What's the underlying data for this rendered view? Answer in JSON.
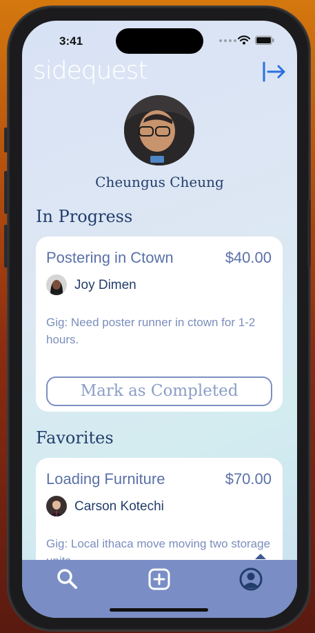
{
  "status": {
    "time": "3:41"
  },
  "app": {
    "logo": "sidequest"
  },
  "profile": {
    "name": "Cheungus Cheung"
  },
  "in_progress": {
    "title": "In Progress",
    "card": {
      "title": "Postering in Ctown",
      "price": "$40.00",
      "user": "Joy Dimen",
      "description": "Gig: Need poster runner in ctown for 1-2 hours.",
      "action_label": "Mark as Completed"
    }
  },
  "favorites": {
    "title": "Favorites",
    "card": {
      "title": "Loading Furniture",
      "price": "$70.00",
      "user": "Carson Kotechi",
      "description": "Gig: Local ithaca move moving two storage units"
    }
  },
  "tabs": [
    {
      "icon": "search-icon"
    },
    {
      "icon": "add-square-icon"
    },
    {
      "icon": "profile-icon"
    }
  ],
  "colors": {
    "accent": "#223d6b",
    "card_text": "#5a70a8",
    "tab_bar": "#7a8ec5",
    "logout": "#2a6fe0"
  }
}
